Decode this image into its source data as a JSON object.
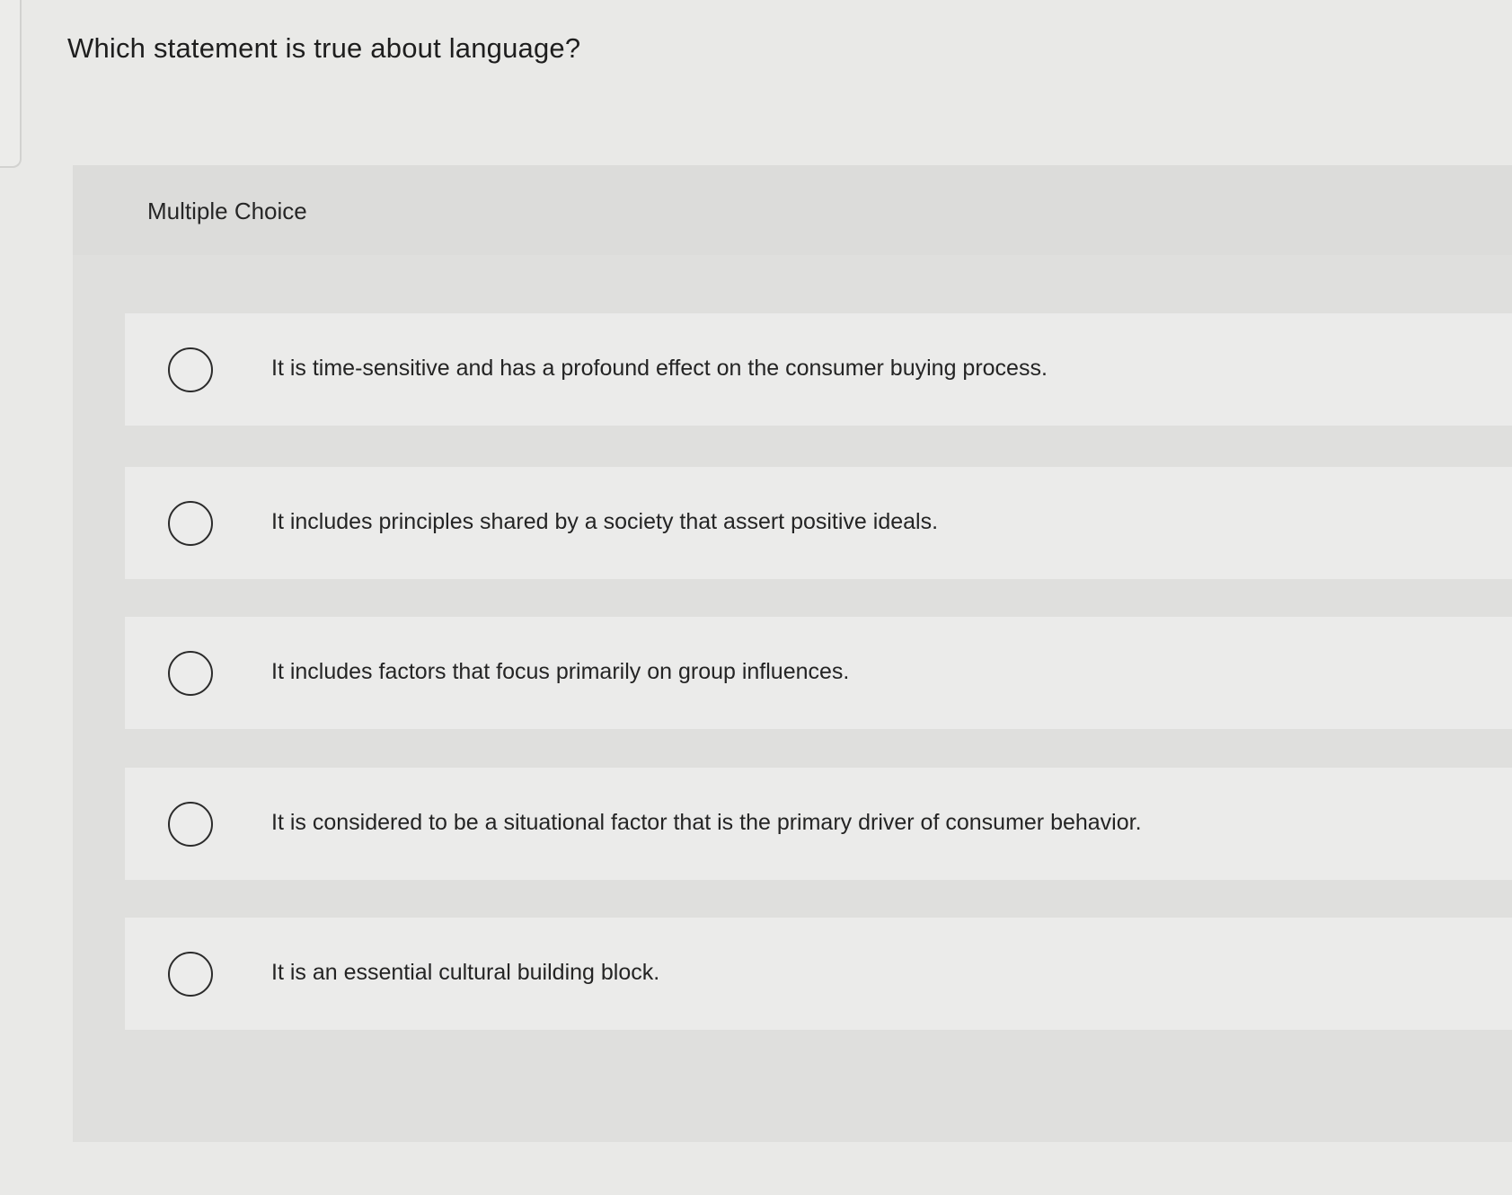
{
  "question": {
    "text": "Which statement is true about language?"
  },
  "quiz": {
    "type_label": "Multiple Choice",
    "options": [
      {
        "label": "It is time-sensitive and has a profound effect on the consumer buying process."
      },
      {
        "label": "It includes principles shared by a society that assert positive ideals."
      },
      {
        "label": "It includes factors that focus primarily on group influences."
      },
      {
        "label": "It is considered to be a situational factor that is the primary driver of consumer behavior."
      },
      {
        "label": "It is an essential cultural building block."
      }
    ]
  }
}
